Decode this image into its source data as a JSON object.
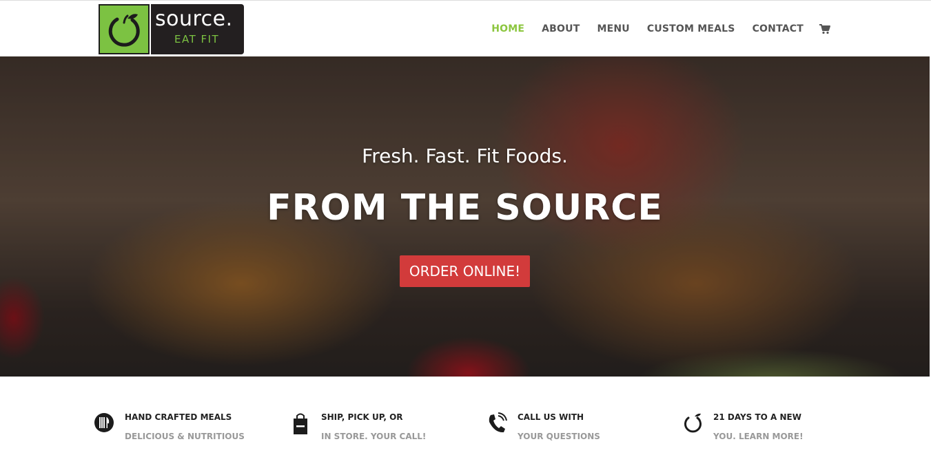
{
  "brand": {
    "logo_word": "source.",
    "logo_tagline": "EAT FIT",
    "green": "#7cc242",
    "accent_red": "#d23b3b"
  },
  "nav": {
    "items": [
      {
        "label": "HOME",
        "active": true
      },
      {
        "label": "ABOUT",
        "active": false
      },
      {
        "label": "MENU",
        "active": false
      },
      {
        "label": "CUSTOM MEALS",
        "active": false
      },
      {
        "label": "CONTACT",
        "active": false
      }
    ],
    "cart_icon": "cart-icon"
  },
  "hero": {
    "subtitle": "Fresh. Fast. Fit Foods.",
    "title": "FROM THE SOURCE",
    "button_label": "ORDER ONLINE!"
  },
  "features": [
    {
      "icon": "utensils-icon",
      "line1": "HAND CRAFTED MEALS",
      "line2": "DELICIOUS & NUTRITIOUS"
    },
    {
      "icon": "shopping-bag-icon",
      "line1": "SHIP, PICK UP, OR",
      "line2": "IN STORE. YOUR CALL!"
    },
    {
      "icon": "phone-icon",
      "line1": "CALL US WITH",
      "line2": "YOUR QUESTIONS"
    },
    {
      "icon": "apple-logo-icon",
      "line1": "21 DAYS TO A NEW",
      "line2": "YOU. LEARN MORE!"
    }
  ]
}
